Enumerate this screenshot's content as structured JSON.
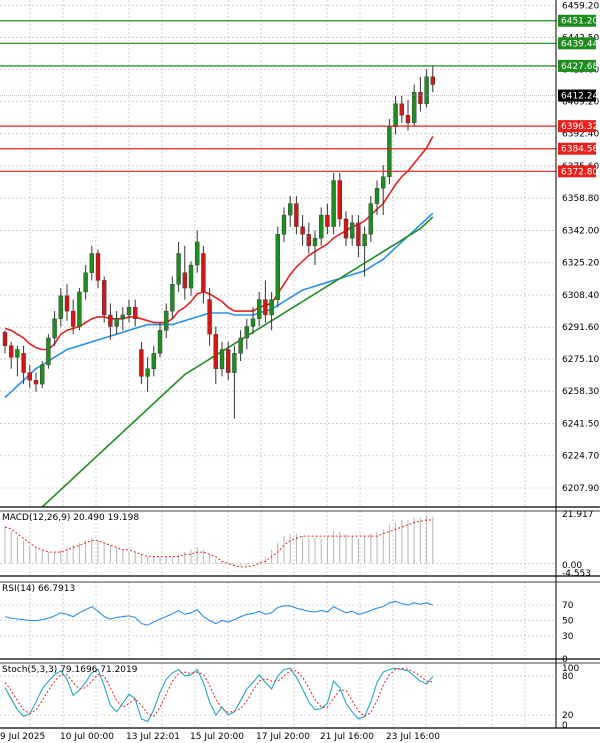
{
  "chart_data": [
    {
      "type": "candlestick",
      "panel": "price",
      "y_ticks": [
        "6459.20",
        "6442.50",
        "6425.80",
        "6409.20",
        "6392.40",
        "6375.60",
        "6358.80",
        "6342.00",
        "6325.20",
        "6308.40",
        "6291.60",
        "6275.10",
        "6258.30",
        "6241.50",
        "6224.70",
        "6207.90"
      ],
      "ylim": [
        6198,
        6462
      ],
      "current_price": "6412.24",
      "levels": [
        {
          "value": 6451.2,
          "label": "6451.20",
          "color": "#1e8c1e"
        },
        {
          "value": 6439.44,
          "label": "6439.44",
          "color": "#1e8c1e"
        },
        {
          "value": 6427.68,
          "label": "6427.68",
          "color": "#1e8c1e"
        },
        {
          "value": 6396.32,
          "label": "6396.32",
          "color": "#e8201c"
        },
        {
          "value": 6384.56,
          "label": "6384.56",
          "color": "#e8201c"
        },
        {
          "value": 6372.8,
          "label": "6372.80",
          "color": "#e8201c"
        }
      ],
      "x_labels": [
        "9 Jul 2025",
        "10 Jul 00:00",
        "13 Jul 22:01",
        "15 Jul 20:00",
        "17 Jul 20:00",
        "21 Jul 16:00",
        "23 Jul 16:00"
      ],
      "candles": [
        [
          6289,
          6290,
          6278,
          6282
        ],
        [
          6282,
          6284,
          6270,
          6276
        ],
        [
          6276,
          6282,
          6266,
          6280
        ],
        [
          6278,
          6282,
          6262,
          6268
        ],
        [
          6268,
          6272,
          6260,
          6264
        ],
        [
          6264,
          6268,
          6258,
          6262
        ],
        [
          6262,
          6274,
          6260,
          6272
        ],
        [
          6272,
          6288,
          6270,
          6286
        ],
        [
          6286,
          6300,
          6282,
          6296
        ],
        [
          6296,
          6312,
          6292,
          6308
        ],
        [
          6308,
          6314,
          6295,
          6300
        ],
        [
          6300,
          6306,
          6288,
          6292
        ],
        [
          6292,
          6312,
          6290,
          6310
        ],
        [
          6310,
          6324,
          6306,
          6320
        ],
        [
          6320,
          6334,
          6316,
          6330
        ],
        [
          6330,
          6332,
          6312,
          6316
        ],
        [
          6316,
          6318,
          6294,
          6298
        ],
        [
          6298,
          6304,
          6285,
          6292
        ],
        [
          6292,
          6300,
          6288,
          6296
        ],
        [
          6296,
          6302,
          6290,
          6298
        ],
        [
          6298,
          6306,
          6294,
          6302
        ],
        [
          6302,
          6306,
          6292,
          6296
        ],
        [
          6280,
          6284,
          6262,
          6266
        ],
        [
          6266,
          6276,
          6258,
          6270
        ],
        [
          6270,
          6282,
          6266,
          6278
        ],
        [
          6278,
          6294,
          6276,
          6290
        ],
        [
          6290,
          6304,
          6286,
          6300
        ],
        [
          6300,
          6318,
          6296,
          6314
        ],
        [
          6314,
          6336,
          6310,
          6330
        ],
        [
          6320,
          6334,
          6306,
          6312
        ],
        [
          6312,
          6326,
          6308,
          6324
        ],
        [
          6324,
          6342,
          6320,
          6336
        ],
        [
          6330,
          6334,
          6304,
          6310
        ],
        [
          6306,
          6312,
          6282,
          6288
        ],
        [
          6288,
          6292,
          6262,
          6270
        ],
        [
          6270,
          6284,
          6266,
          6280
        ],
        [
          6280,
          6284,
          6264,
          6268
        ],
        [
          6268,
          6282,
          6244,
          6278
        ],
        [
          6278,
          6290,
          6274,
          6286
        ],
        [
          6286,
          6296,
          6280,
          6292
        ],
        [
          6292,
          6302,
          6288,
          6296
        ],
        [
          6296,
          6310,
          6292,
          6306
        ],
        [
          6306,
          6316,
          6294,
          6298
        ],
        [
          6298,
          6310,
          6290,
          6306
        ],
        [
          6306,
          6344,
          6302,
          6340
        ],
        [
          6340,
          6354,
          6336,
          6350
        ],
        [
          6350,
          6360,
          6344,
          6356
        ],
        [
          6356,
          6360,
          6340,
          6344
        ],
        [
          6344,
          6350,
          6334,
          6340
        ],
        [
          6340,
          6346,
          6330,
          6334
        ],
        [
          6334,
          6342,
          6324,
          6338
        ],
        [
          6338,
          6354,
          6334,
          6350
        ],
        [
          6350,
          6356,
          6340,
          6344
        ],
        [
          6344,
          6372,
          6340,
          6368
        ],
        [
          6368,
          6372,
          6344,
          6348
        ],
        [
          6348,
          6352,
          6334,
          6338
        ],
        [
          6338,
          6350,
          6334,
          6346
        ],
        [
          6346,
          6350,
          6328,
          6334
        ],
        [
          6334,
          6344,
          6318,
          6340
        ],
        [
          6340,
          6360,
          6336,
          6356
        ],
        [
          6356,
          6368,
          6350,
          6364
        ],
        [
          6364,
          6376,
          6350,
          6370
        ],
        [
          6370,
          6400,
          6366,
          6396
        ],
        [
          6396,
          6412,
          6392,
          6408
        ],
        [
          6408,
          6412,
          6398,
          6402
        ],
        [
          6402,
          6410,
          6394,
          6398
        ],
        [
          6398,
          6418,
          6396,
          6414
        ],
        [
          6414,
          6422,
          6404,
          6408
        ],
        [
          6408,
          6426,
          6406,
          6422
        ],
        [
          6422,
          6428,
          6414,
          6418
        ]
      ],
      "series": [
        {
          "color": "#e8201c",
          "values": [
            6291,
            6290,
            6288,
            6286,
            6283,
            6281,
            6280,
            6280,
            6283,
            6288,
            6290,
            6291,
            6292,
            6294,
            6296,
            6297,
            6297,
            6296,
            6296,
            6296,
            6297,
            6297,
            6296,
            6295,
            6294,
            6294,
            6294,
            6296,
            6300,
            6302,
            6305,
            6309,
            6310,
            6309,
            6307,
            6305,
            6302,
            6300,
            6300,
            6300,
            6300,
            6302,
            6303,
            6304,
            6309,
            6314,
            6319,
            6323,
            6326,
            6329,
            6331,
            6333,
            6335,
            6338,
            6340,
            6342,
            6344,
            6345,
            6347,
            6350,
            6353,
            6356,
            6361,
            6366,
            6370,
            6373,
            6377,
            6381,
            6385,
            6391
          ]
        },
        {
          "color": "#2a90e8",
          "values": [
            6255,
            6258,
            6261,
            6264,
            6267,
            6270,
            6272,
            6274,
            6276,
            6278,
            6280,
            6281,
            6282,
            6283,
            6284,
            6285,
            6286,
            6287,
            6288,
            6289,
            6290,
            6291,
            6292,
            6293,
            6293,
            6293,
            6293,
            6293,
            6294,
            6295,
            6296,
            6297,
            6298,
            6299,
            6299,
            6299,
            6299,
            6298,
            6298,
            6298,
            6298,
            6299,
            6300,
            6301,
            6303,
            6305,
            6307,
            6309,
            6311,
            6312,
            6313,
            6314,
            6315,
            6316,
            6317,
            6318,
            6319,
            6320,
            6321,
            6323,
            6325,
            6327,
            6330,
            6333,
            6336,
            6339,
            6342,
            6345,
            6348,
            6351
          ]
        },
        {
          "color": "#1e8c1e",
          "values": [
            6180,
            6183,
            6186,
            6189,
            6192,
            6195,
            6198,
            6201,
            6204,
            6207,
            6210,
            6213,
            6216,
            6219,
            6222,
            6225,
            6228,
            6231,
            6234,
            6237,
            6240,
            6243,
            6246,
            6249,
            6252,
            6255,
            6258,
            6261,
            6264,
            6267,
            6269,
            6271,
            6273,
            6275,
            6277,
            6279,
            6281,
            6283,
            6285,
            6287,
            6289,
            6291,
            6293,
            6295,
            6297,
            6299,
            6301,
            6303,
            6305,
            6307,
            6309,
            6311,
            6313,
            6315,
            6317,
            6319,
            6321,
            6323,
            6325,
            6327,
            6329,
            6331,
            6333,
            6335,
            6337,
            6339,
            6341,
            6343,
            6346,
            6349
          ]
        }
      ]
    },
    {
      "type": "macd",
      "panel": "macd",
      "title": "MACD(12,26,9) 20.490 19.198",
      "y_ticks": [
        "21.917",
        "0.00",
        "-4.553"
      ],
      "ylim": [
        -5.5,
        23
      ],
      "histogram": [
        16,
        14,
        12,
        10,
        8,
        7,
        6,
        5,
        5,
        6,
        7,
        8,
        9,
        10,
        11,
        10,
        9,
        8,
        7,
        6,
        5,
        5,
        4,
        3,
        3,
        3,
        3,
        3,
        4,
        5,
        6,
        7,
        6,
        4,
        2,
        1,
        0,
        -1,
        -1,
        -1,
        0,
        1,
        3,
        6,
        9,
        12,
        13,
        13,
        12,
        11,
        11,
        11,
        12,
        14,
        14,
        13,
        12,
        11,
        12,
        13,
        14,
        15,
        17,
        18,
        19,
        19,
        20,
        20,
        21,
        20.5
      ],
      "signal": [
        16,
        15,
        13,
        11,
        9,
        7,
        6,
        5,
        5,
        5,
        6,
        7,
        8,
        9,
        10,
        10,
        9,
        8,
        7,
        6,
        6,
        5,
        4,
        3,
        3,
        3,
        3,
        3,
        3,
        4,
        4,
        5,
        5,
        4,
        3,
        1,
        0,
        -1,
        -1.5,
        -1.5,
        -1,
        0,
        1,
        3,
        5,
        8,
        10,
        11,
        12,
        12,
        12,
        12,
        12,
        12,
        12,
        12,
        12,
        12,
        12,
        12,
        12,
        13,
        14,
        15,
        16,
        17,
        18,
        18.5,
        19,
        19.2
      ]
    },
    {
      "type": "line",
      "panel": "rsi",
      "title": "RSI(14) 66.7913",
      "y_ticks": [
        "70",
        "50",
        "30",
        "0"
      ],
      "ylim": [
        0,
        100
      ],
      "series": [
        {
          "color": "#2a90e8",
          "values": [
            55,
            53,
            52,
            51,
            50,
            50,
            51,
            53,
            56,
            60,
            58,
            55,
            60,
            64,
            68,
            62,
            55,
            52,
            54,
            55,
            56,
            54,
            46,
            44,
            48,
            52,
            55,
            59,
            63,
            58,
            60,
            64,
            55,
            50,
            46,
            50,
            48,
            51,
            55,
            58,
            59,
            62,
            58,
            60,
            67,
            69,
            69,
            66,
            64,
            62,
            61,
            63,
            61,
            68,
            64,
            60,
            62,
            58,
            60,
            63,
            66,
            68,
            73,
            75,
            72,
            70,
            73,
            71,
            73,
            70
          ]
        }
      ]
    },
    {
      "type": "stochastic",
      "panel": "stoch",
      "title": "Stoch(5,3,3) 79.1696 71.2019",
      "y_ticks": [
        "100",
        "80",
        "20",
        "0"
      ],
      "ylim": [
        0,
        100
      ],
      "series": [
        {
          "color": "#20a8c8",
          "values": [
            62,
            45,
            28,
            18,
            22,
            40,
            60,
            72,
            82,
            88,
            75,
            50,
            58,
            70,
            85,
            90,
            65,
            35,
            25,
            38,
            52,
            45,
            14,
            10,
            28,
            55,
            75,
            85,
            90,
            80,
            82,
            90,
            70,
            40,
            20,
            32,
            20,
            25,
            42,
            60,
            70,
            82,
            70,
            60,
            80,
            90,
            92,
            78,
            60,
            40,
            28,
            30,
            38,
            72,
            62,
            38,
            25,
            14,
            18,
            40,
            70,
            86,
            90,
            92,
            90,
            88,
            80,
            72,
            68,
            79
          ]
        },
        {
          "color": "#e8201c",
          "values": [
            70,
            58,
            42,
            28,
            22,
            28,
            42,
            58,
            72,
            82,
            82,
            70,
            60,
            62,
            72,
            82,
            80,
            62,
            42,
            32,
            38,
            45,
            35,
            22,
            18,
            32,
            52,
            72,
            84,
            86,
            84,
            86,
            82,
            66,
            44,
            30,
            24,
            26,
            30,
            42,
            58,
            72,
            76,
            72,
            72,
            80,
            88,
            88,
            78,
            62,
            44,
            32,
            32,
            46,
            58,
            58,
            42,
            26,
            18,
            24,
            42,
            66,
            82,
            90,
            92,
            90,
            86,
            80,
            72,
            71
          ]
        }
      ]
    }
  ]
}
